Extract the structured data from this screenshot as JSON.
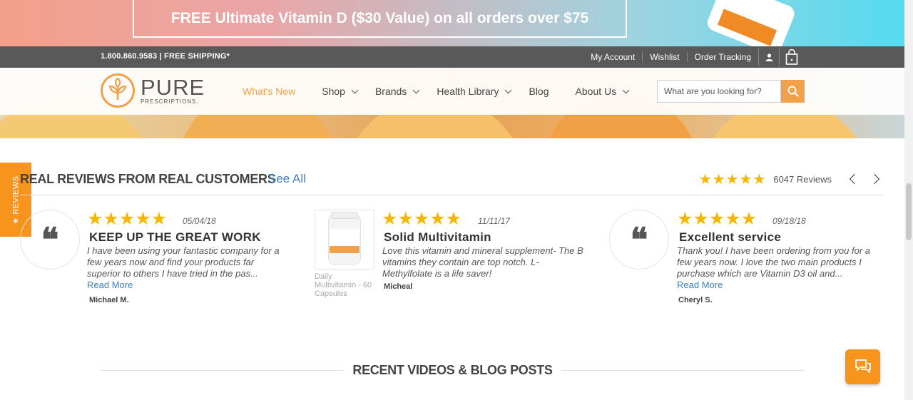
{
  "promo": {
    "text": "FREE Ultimate Vitamin D ($30 Value) on all orders over $75"
  },
  "utility": {
    "phone": "1.800.860.9583 | FREE SHIPPING*",
    "links": [
      "My Account",
      "Wishlist",
      "Order Tracking"
    ]
  },
  "logo": {
    "name": "PURE",
    "sub": "PRESCRIPTIONS."
  },
  "nav": {
    "items": [
      {
        "label": "What's New",
        "dropdown": false,
        "active": true
      },
      {
        "label": "Shop",
        "dropdown": true
      },
      {
        "label": "Brands",
        "dropdown": true
      },
      {
        "label": "Health Library",
        "dropdown": true
      },
      {
        "label": "Blog",
        "dropdown": false
      },
      {
        "label": "About Us",
        "dropdown": true
      }
    ],
    "search_placeholder": "What are you looking for?"
  },
  "reviews_tab": {
    "label": "★ REVIEWS"
  },
  "reviews": {
    "title": "REAL REVIEWS FROM REAL CUSTOMERS",
    "see_all": "See All",
    "stars": "★★★★★",
    "count": "6047 Reviews",
    "items": [
      {
        "date": "05/04/18",
        "title": "KEEP UP THE GREAT WORK",
        "body": "I have been using your fantastic company for a few years now and find your products far superior to others I have tried in the pas...",
        "read_more": "Read More",
        "author": "Michael M."
      },
      {
        "date": "11/11/17",
        "title": "Solid Multivitamin",
        "body": "Love this vitamin and mineral supplement- The B vitamins they contain are top notch. L-Methylfolate is a life saver!",
        "author": "Micheal",
        "product_caption": "Daily Multivitamin - 60 Capsules"
      },
      {
        "date": "09/18/18",
        "title": "Excellent service",
        "body": "Thank you! I have been ordering from you for a few years now. I love the two main products I purchase which are Vitamin D3 oil and...",
        "read_more": "Read More",
        "author": "Cheryl S."
      }
    ]
  },
  "recent": {
    "title": "RECENT VIDEOS & BLOG POSTS"
  },
  "colors": {
    "accent": "#f0a14a",
    "orange": "#f7941d",
    "link": "#3b7fc4",
    "star": "#f5b800"
  }
}
